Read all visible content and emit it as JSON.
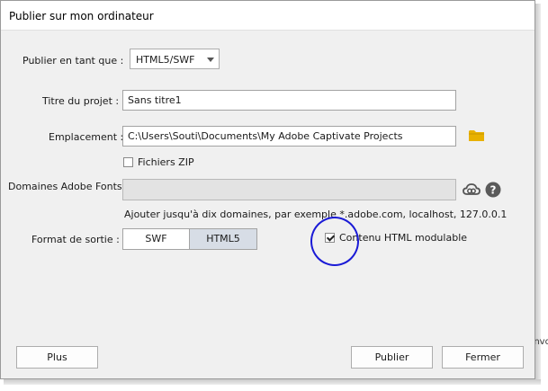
{
  "window": {
    "title": "Publier sur mon ordinateur"
  },
  "publish_as": {
    "label": "Publier en tant que :",
    "selected": "HTML5/SWF"
  },
  "project_title": {
    "label": "Titre du projet :",
    "value": "Sans titre1"
  },
  "location": {
    "label": "Emplacement :",
    "value": "C:\\Users\\Souti\\Documents\\My Adobe Captivate Projects",
    "folder_icon": "folder-icon"
  },
  "zip": {
    "label": "Fichiers ZIP",
    "checked": false
  },
  "adobe_fonts": {
    "label": "Domaines Adobe Fonts :",
    "value": "",
    "hint": "Ajouter jusqu'à dix domaines, par exemple *.adobe.com, localhost, 127.0.0.1",
    "cloud_icon": "creative-cloud-icon",
    "help_icon": "help-icon"
  },
  "output_format": {
    "label": "Format de sortie :",
    "options": [
      "SWF",
      "HTML5"
    ],
    "selected": "HTML5"
  },
  "scalable_html": {
    "label": "Contenu HTML modulable",
    "checked": true
  },
  "buttons": {
    "more": "Plus",
    "publish": "Publier",
    "close": "Fermer"
  },
  "background_fragment": "Envo",
  "colors": {
    "annotation_circle": "#1a1ad6",
    "folder": "#e8b100",
    "selected_segment": "#d7dde6"
  }
}
